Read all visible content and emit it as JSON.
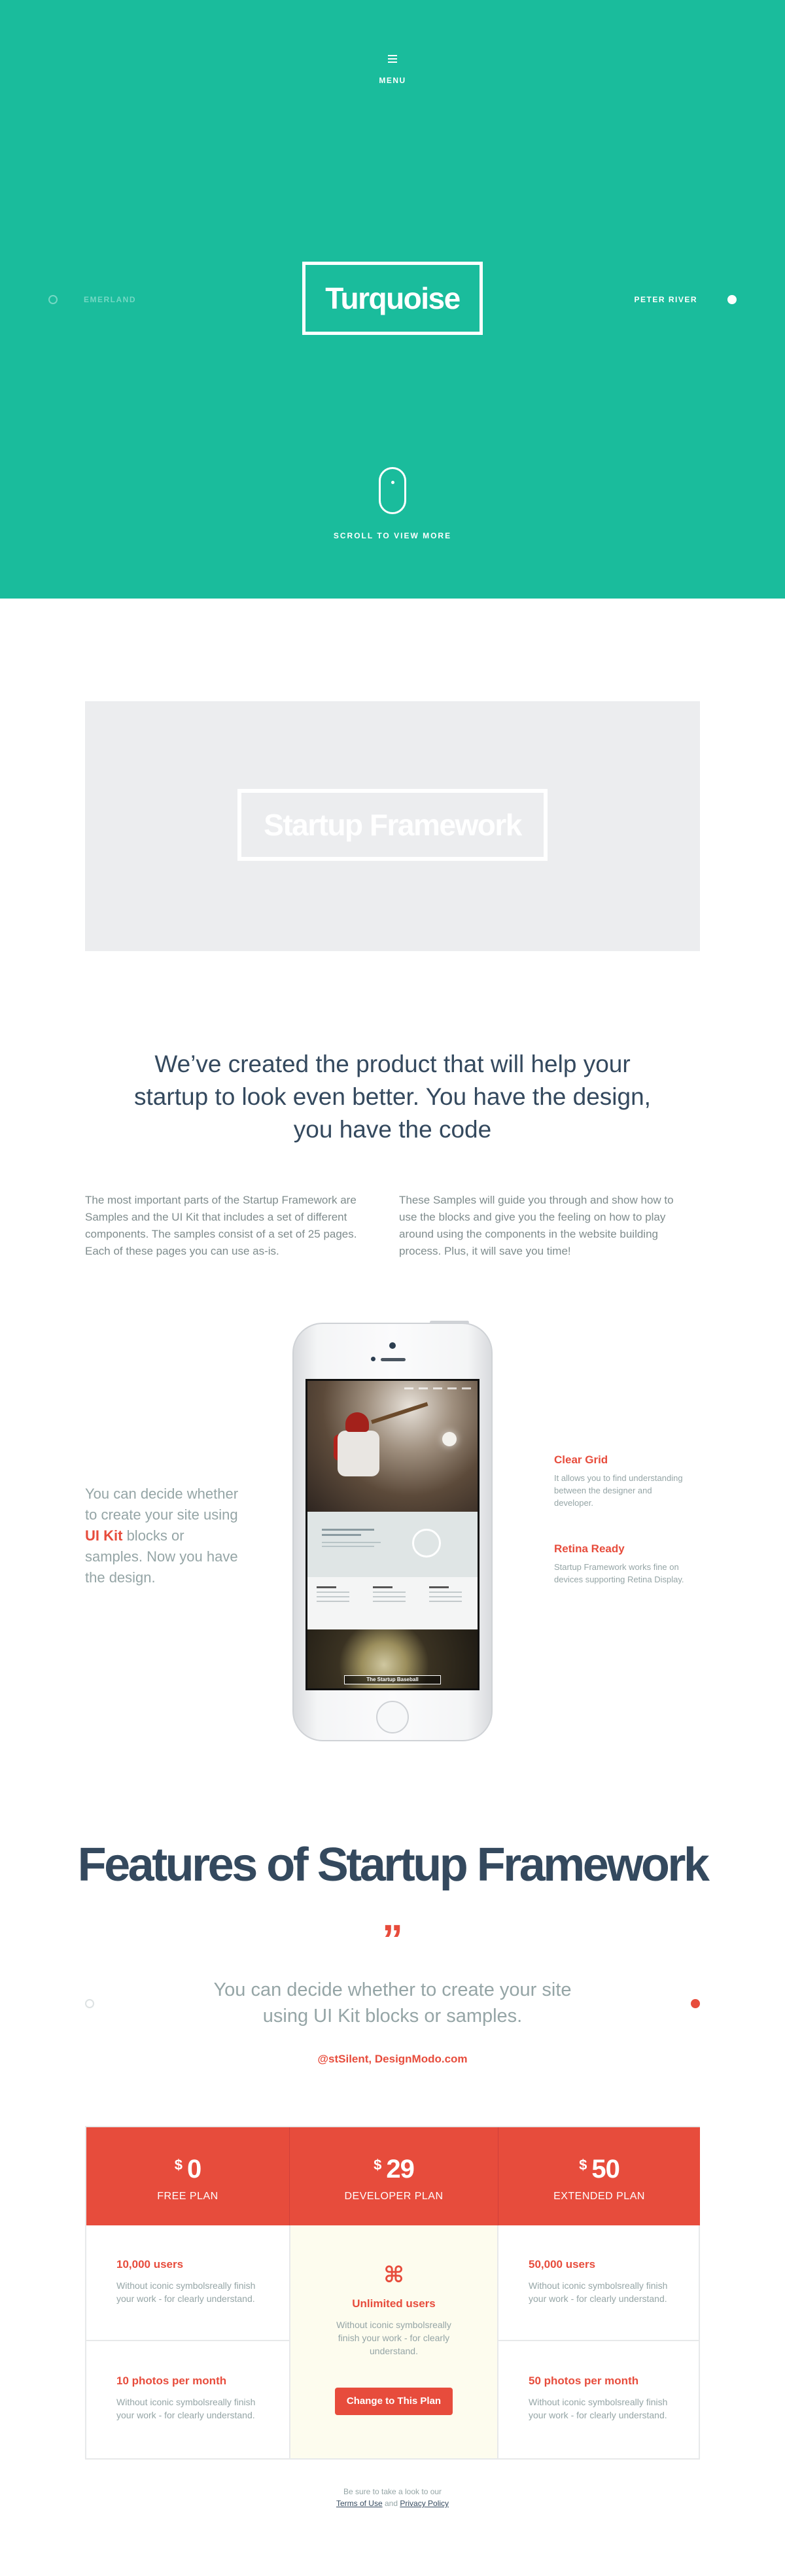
{
  "hero": {
    "menu_label": "MENU",
    "title": "Turquoise",
    "prev_label": "EMERLAND",
    "next_label": "PETER RIVER",
    "scroll_label": "SCROLL TO VIEW MORE",
    "background": "#1abc9c"
  },
  "banner": {
    "title": "Startup Framework"
  },
  "intro": {
    "headline": "We’ve created the product that will help your startup to look even better. You have the design, you have the code",
    "col_left": "The most important parts of the Startup Framework are Samples and the UI Kit that includes a set of different components. The samples consist of a set of 25 pages. Each of these pages you can use as-is.",
    "col_right": "These Samples will guide you through and show how to use the blocks and give you the feeling on how to play around using the components in the website building process. Plus, it will save you time!"
  },
  "phone_section": {
    "text_before": "You can decide whether to create your site using ",
    "link": "UI Kit",
    "text_after": " blocks or samples. Now you have the design.",
    "screen_caption": "The Startup Baseball",
    "features": [
      {
        "title": "Clear Grid",
        "text": "It allows you to find understanding between the designer and developer."
      },
      {
        "title": "Retina Ready",
        "text": "Startup Framework works fine on devices supporting Retina Display."
      }
    ]
  },
  "features": {
    "title": "Features of Startup Framework",
    "quote_mark": "”",
    "quote": "You can decide whether to create your site using UI Kit blocks or samples.",
    "author": "@stSilent, DesignModo.com"
  },
  "pricing": {
    "plans": [
      {
        "currency": "$",
        "price": "0",
        "name": "FREE PLAN"
      },
      {
        "currency": "$",
        "price": "29",
        "name": "DEVELOPER PLAN"
      },
      {
        "currency": "$",
        "price": "50",
        "name": "EXTENDED PLAN"
      }
    ],
    "free": [
      {
        "title": "10,000 users",
        "text": "Without  iconic symbolsreally finish your work - for clearly understand."
      },
      {
        "title": "10 photos per month",
        "text": "Without  iconic symbolsreally finish your work - for clearly understand."
      }
    ],
    "developer": {
      "icon": "⌘",
      "title": "Unlimited users",
      "text": "Without  iconic symbolsreally finish your work - for clearly understand.",
      "button": "Change to This Plan"
    },
    "extended": [
      {
        "title": "50,000 users",
        "text": "Without  iconic symbolsreally finish your work - for clearly understand."
      },
      {
        "title": "50 photos per month",
        "text": "Without  iconic symbolsreally finish your work - for clearly understand."
      }
    ]
  },
  "footer": {
    "text": "Be sure to take a look to our",
    "terms": "Terms of Use",
    "and": "and",
    "privacy": "Privacy Policy"
  }
}
